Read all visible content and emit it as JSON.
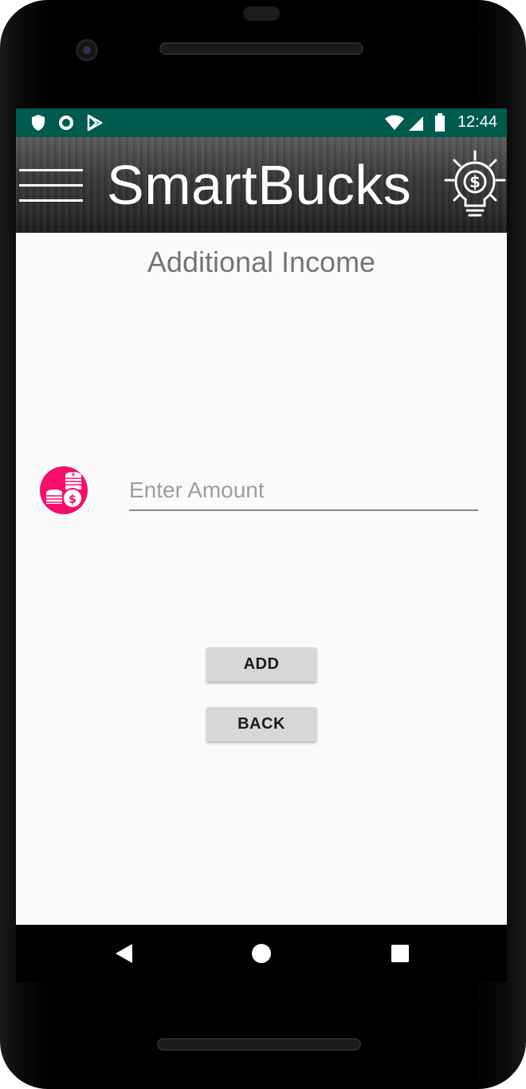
{
  "status_bar": {
    "time": "12:44",
    "left_icons": [
      "shield-icon",
      "circle-icon",
      "play-store-icon"
    ],
    "right_icons": [
      "wifi-icon",
      "signal-icon",
      "battery-icon"
    ],
    "background": "#005b4f"
  },
  "app_bar": {
    "title": "SmartBucks",
    "menu_icon": "hamburger-menu-icon",
    "action_icon": "lightbulb-dollar-icon"
  },
  "page": {
    "title": "Additional Income",
    "income_icon": "coins-icon",
    "amount_input": {
      "value": "",
      "placeholder": "Enter Amount"
    },
    "add_button_label": "ADD",
    "back_button_label": "BACK"
  },
  "nav_bar": {
    "icons": [
      "back-triangle-icon",
      "home-circle-icon",
      "recents-square-icon"
    ]
  },
  "colors": {
    "accent": "#f50f6a",
    "status_bar": "#005b4f",
    "button": "#d6d7d7"
  }
}
